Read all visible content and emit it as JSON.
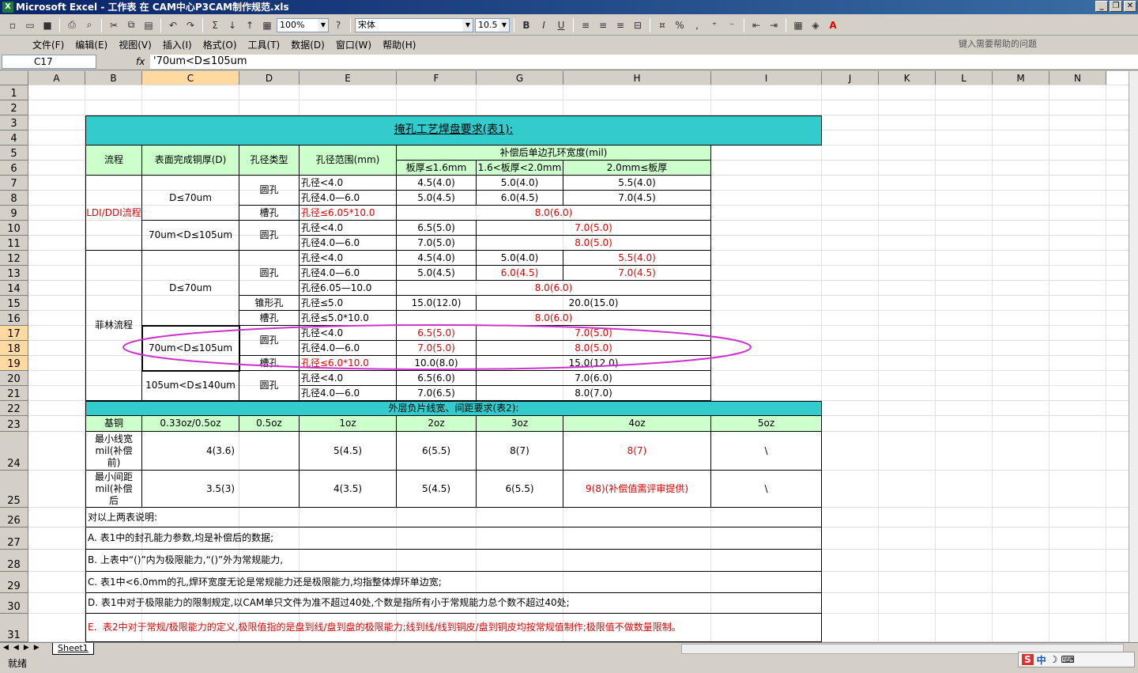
{
  "window": {
    "title": "Microsoft Excel - 工作表 在 CAM中心P3CAM制作规范.xls",
    "app_icon": "X"
  },
  "toolbar": {
    "zoom": "100%",
    "font": "宋体",
    "size": "10.5",
    "bold": "B",
    "italic": "I",
    "underline": "U",
    "sigma": "Σ",
    "percent": "%",
    "comma": ","
  },
  "menu": [
    "文件(F)",
    "编辑(E)",
    "视图(V)",
    "插入(I)",
    "格式(O)",
    "工具(T)",
    "数据(D)",
    "窗口(W)",
    "帮助(H)"
  ],
  "help_placeholder": "键入需要帮助的问题",
  "formula": {
    "name_box": "C17",
    "fx": "fx",
    "value": "'70um<D≤105um"
  },
  "columns": [
    "A",
    "B",
    "C",
    "D",
    "E",
    "F",
    "G",
    "H",
    "I",
    "J",
    "K",
    "L",
    "M",
    "N"
  ],
  "rows": [
    "1",
    "2",
    "3",
    "4",
    "5",
    "6",
    "7",
    "8",
    "9",
    "10",
    "11",
    "12",
    "13",
    "14",
    "15",
    "16",
    "17",
    "18",
    "19",
    "20",
    "21",
    "22",
    "23",
    "24",
    "25",
    "26",
    "27",
    "28",
    "29",
    "30",
    "31"
  ],
  "cells": [
    {
      "t": "掩孔工艺焊盘要求(表1):",
      "c": "teal"
    },
    {
      "t": "流程",
      "c": "green"
    },
    {
      "t": "表面完成铜厚(D)",
      "c": "green"
    },
    {
      "t": "孔径类型",
      "c": "green"
    },
    {
      "t": "孔径范围(mm)",
      "c": "green"
    },
    {
      "t": "补偿后单边孔环宽度(mil)",
      "c": "green"
    },
    {
      "t": "板厚≤1.6mm",
      "c": "green"
    },
    {
      "t": "1.6<板厚<2.0mm",
      "c": "green"
    },
    {
      "t": "2.0mm≤板厚",
      "c": "green"
    },
    {
      "t": "LDI/DDI流程",
      "c": "red"
    },
    {
      "t": "D≤70um"
    },
    {
      "t": "圆孔"
    },
    {
      "t": "孔径<4.0"
    },
    {
      "t": "4.5(4.0)"
    },
    {
      "t": "5.0(4.0)"
    },
    {
      "t": "5.5(4.0)"
    },
    {
      "t": "孔径4.0—6.0"
    },
    {
      "t": "5.0(4.5)"
    },
    {
      "t": "6.0(4.5)"
    },
    {
      "t": "7.0(4.5)"
    },
    {
      "t": "槽孔"
    },
    {
      "t": "孔径≤6.05*10.0",
      "c": "red"
    },
    {
      "t": "8.0(6.0)",
      "c": "red"
    },
    {
      "t": "70um<D≤105um"
    },
    {
      "t": "圆孔"
    },
    {
      "t": "孔径<4.0"
    },
    {
      "t": "6.5(5.0)"
    },
    {
      "t": "7.0(5.0)",
      "c": "red"
    },
    {
      "t": "孔径4.0—6.0"
    },
    {
      "t": "7.0(5.0)"
    },
    {
      "t": "8.0(5.0)",
      "c": "red"
    },
    {
      "t": "菲林流程"
    },
    {
      "t": "D≤70um"
    },
    {
      "t": "圆孔"
    },
    {
      "t": "孔径<4.0"
    },
    {
      "t": "4.5(4.0)"
    },
    {
      "t": "5.0(4.0)"
    },
    {
      "t": "5.5(4.0)",
      "c": "red"
    },
    {
      "t": "孔径4.0—6.0"
    },
    {
      "t": "5.0(4.5)"
    },
    {
      "t": "6.0(4.5)",
      "c": "red"
    },
    {
      "t": "7.0(4.5)",
      "c": "red"
    },
    {
      "t": "孔径6.05—10.0"
    },
    {
      "t": "8.0(6.0)",
      "c": "red"
    },
    {
      "t": "锥形孔"
    },
    {
      "t": "孔径≤5.0"
    },
    {
      "t": "15.0(12.0)"
    },
    {
      "t": "20.0(15.0)"
    },
    {
      "t": "槽孔"
    },
    {
      "t": "孔径≤5.0*10.0"
    },
    {
      "t": "8.0(6.0)",
      "c": "red"
    },
    {
      "t": "70um<D≤105um"
    },
    {
      "t": "圆孔"
    },
    {
      "t": "孔径<4.0"
    },
    {
      "t": "6.5(5.0)",
      "c": "red"
    },
    {
      "t": "7.0(5.0)",
      "c": "red"
    },
    {
      "t": "孔径4.0—6.0"
    },
    {
      "t": "7.0(5.0)",
      "c": "red"
    },
    {
      "t": "8.0(5.0)",
      "c": "red"
    },
    {
      "t": "槽孔"
    },
    {
      "t": "孔径≤6.0*10.0",
      "c": "red"
    },
    {
      "t": "10.0(8.0)"
    },
    {
      "t": "15.0(12.0)"
    },
    {
      "t": "105um<D≤140um"
    },
    {
      "t": "圆孔"
    },
    {
      "t": "孔径<4.0"
    },
    {
      "t": "6.5(6.0)"
    },
    {
      "t": "7.0(6.0)"
    },
    {
      "t": "孔径4.0—6.0"
    },
    {
      "t": "7.0(6.5)"
    },
    {
      "t": "8.0(7.0)"
    },
    {
      "t": "外层负片线宽、间距要求(表2):",
      "c": "teal"
    },
    {
      "t": "基铜",
      "c": "green"
    },
    {
      "t": "0.33oz/0.5oz",
      "c": "green"
    },
    {
      "t": "0.5oz",
      "c": "green"
    },
    {
      "t": "1oz",
      "c": "green"
    },
    {
      "t": "2oz",
      "c": "green"
    },
    {
      "t": "3oz",
      "c": "green"
    },
    {
      "t": "4oz",
      "c": "green"
    },
    {
      "t": "5oz",
      "c": "green"
    },
    {
      "t": "最小线宽\nmil(补偿\n前)"
    },
    {
      "t": "4(3.6)"
    },
    {
      "t": "5(4.5)"
    },
    {
      "t": "6(5.5)"
    },
    {
      "t": "8(7)"
    },
    {
      "t": "8(7)",
      "c": "red"
    },
    {
      "t": "\\"
    },
    {
      "t": "最小间距\nmil(补偿\n后"
    },
    {
      "t": "3.5(3)"
    },
    {
      "t": "4(3.5)"
    },
    {
      "t": "5(4.5)"
    },
    {
      "t": "6(5.5)"
    },
    {
      "t": "9(8)(补偿值需评审提供)",
      "c": "red"
    },
    {
      "t": "\\"
    },
    {
      "t": "对以上两表说明:"
    },
    {
      "t": "A. 表1中的封孔能力参数,均是补偿后的数据;"
    },
    {
      "t": "B. 上表中“()”内为极限能力,“()”外为常规能力,"
    },
    {
      "t": "C. 表1中<6.0mm的孔,焊环宽度无论是常规能力还是极限能力,均指整体焊环单边宽;"
    },
    {
      "t": "D. 表1中对于极限能力的限制规定,以CAM单只文件为准不超过40处,个数是指所有小于常规能力总个数不超过40处;"
    },
    {
      "t": "E.  表2中对于常规/极限能力的定义,极限值指的是盘到线/盘到盘的极限能力;线到线/线到铜皮/盘到铜皮均按常规值制作;极限值不做数量限制。",
      "c": "red"
    }
  ],
  "sheet_tab": "Sheet1",
  "status": "就绪",
  "ime": {
    "brand": "S",
    "lang": "中"
  },
  "colors": {
    "teal": "#33cccc",
    "green": "#ccffcc",
    "red": "#e00000",
    "highlight_ellipse": "#cc33cc"
  }
}
